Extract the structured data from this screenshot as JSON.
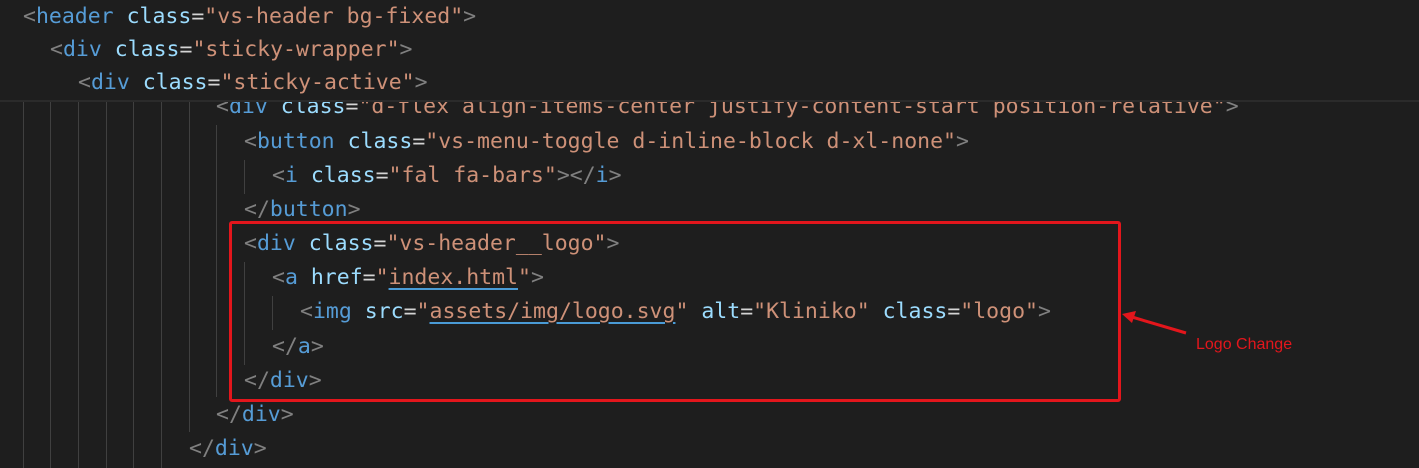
{
  "colors": {
    "background": "#1e1e1e",
    "tag": "#569cd6",
    "attribute": "#9cdcfe",
    "string": "#ce9178",
    "punctuation": "#808080",
    "highlight": "#e3161c"
  },
  "code": {
    "line1": {
      "tag": "header",
      "attr1": "class",
      "val1": "\"vs-header bg-fixed\""
    },
    "line2": {
      "tag": "div",
      "attr1": "class",
      "val1": "\"sticky-wrapper\""
    },
    "line3": {
      "tag": "div",
      "attr1": "class",
      "val1": "\"sticky-active\""
    },
    "line4": {
      "tag": "div",
      "attr1": "class",
      "val1": "\"d-flex align-items-center justify-content-start position-relative\""
    },
    "line5": {
      "tag": "button",
      "attr1": "class",
      "val1": "\"vs-menu-toggle d-inline-block d-xl-none\""
    },
    "line6": {
      "tag": "i",
      "attr1": "class",
      "val1": "\"fal fa-bars\"",
      "close_tag": "i"
    },
    "line7": {
      "close_tag": "button"
    },
    "line8": {
      "tag": "div",
      "attr1": "class",
      "val1": "\"vs-header__logo\""
    },
    "line9": {
      "tag": "a",
      "attr1": "href",
      "q_open": "\"",
      "val1": "index.html",
      "q_close": "\""
    },
    "line10": {
      "tag": "img",
      "attr1": "src",
      "q_open": "\"",
      "val1": "assets/img/logo.svg",
      "q_close": "\"",
      "attr2": "alt",
      "val2": "\"Kliniko\"",
      "attr3": "class",
      "val3": "\"logo\""
    },
    "line11": {
      "close_tag": "a"
    },
    "line12": {
      "close_tag": "div"
    },
    "line13": {
      "close_tag": "div"
    },
    "line14": {
      "close_tag": "div"
    }
  },
  "annotation": {
    "label": "Logo Change"
  }
}
